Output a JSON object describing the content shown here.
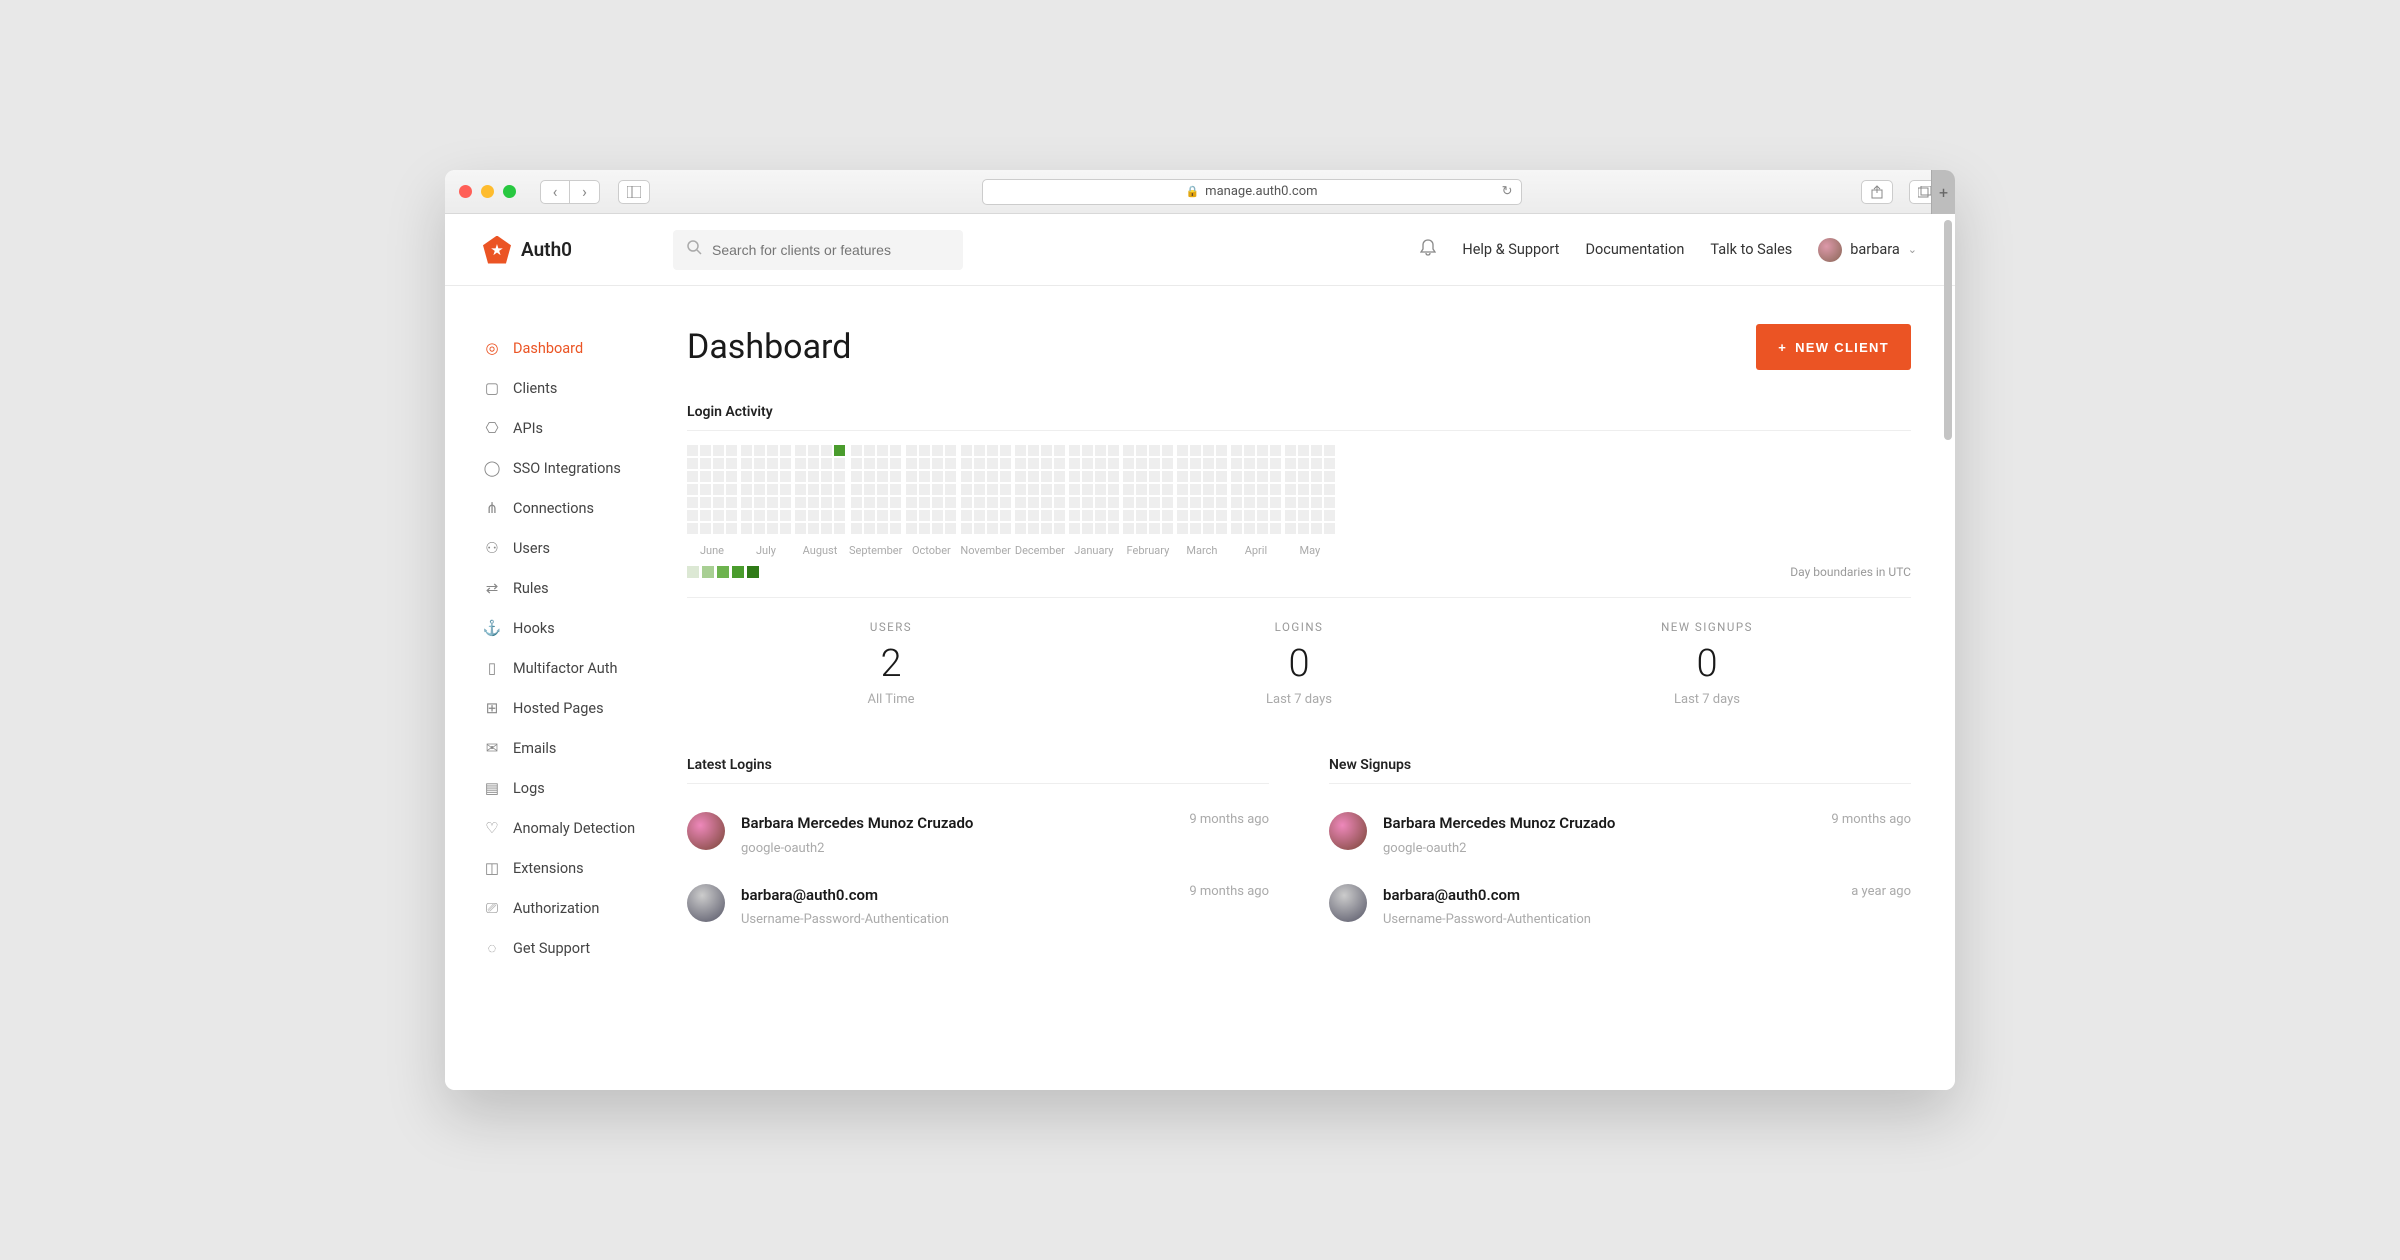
{
  "browser": {
    "url_host": "manage.auth0.com"
  },
  "brand": "Auth0",
  "search": {
    "placeholder": "Search for clients or features"
  },
  "topnav": {
    "help": "Help & Support",
    "docs": "Documentation",
    "sales": "Talk to Sales",
    "user": "barbara"
  },
  "sidebar": {
    "items": [
      {
        "label": "Dashboard",
        "icon": "◎",
        "active": true
      },
      {
        "label": "Clients",
        "icon": "▢"
      },
      {
        "label": "APIs",
        "icon": "⎔"
      },
      {
        "label": "SSO Integrations",
        "icon": "◯"
      },
      {
        "label": "Connections",
        "icon": "⋔"
      },
      {
        "label": "Users",
        "icon": "⚇"
      },
      {
        "label": "Rules",
        "icon": "⇄"
      },
      {
        "label": "Hooks",
        "icon": "⚓"
      },
      {
        "label": "Multifactor Auth",
        "icon": "▯"
      },
      {
        "label": "Hosted Pages",
        "icon": "⊞"
      },
      {
        "label": "Emails",
        "icon": "✉"
      },
      {
        "label": "Logs",
        "icon": "▤"
      },
      {
        "label": "Anomaly Detection",
        "icon": "♡"
      },
      {
        "label": "Extensions",
        "icon": "◫"
      },
      {
        "label": "Authorization",
        "icon": "⎚"
      },
      {
        "label": "Get Support",
        "icon": "◌"
      }
    ]
  },
  "page": {
    "title": "Dashboard",
    "new_btn": "NEW CLIENT"
  },
  "activity": {
    "heading": "Login Activity",
    "months": [
      "June",
      "July",
      "August",
      "September",
      "October",
      "November",
      "December",
      "January",
      "February",
      "March",
      "April",
      "May"
    ],
    "utc_note": "Day boundaries in UTC",
    "active_cell": {
      "month_index": 2,
      "cell_index": 3
    }
  },
  "stats": [
    {
      "label": "USERS",
      "value": "2",
      "sub": "All Time"
    },
    {
      "label": "LOGINS",
      "value": "0",
      "sub": "Last 7 days"
    },
    {
      "label": "NEW SIGNUPS",
      "value": "0",
      "sub": "Last 7 days"
    }
  ],
  "latest_logins": {
    "heading": "Latest Logins",
    "items": [
      {
        "name": "Barbara Mercedes Munoz Cruzado",
        "provider": "google-oauth2",
        "time": "9 months ago"
      },
      {
        "name": "barbara@auth0.com",
        "provider": "Username-Password-Authentication",
        "time": "9 months ago"
      }
    ]
  },
  "new_signups": {
    "heading": "New Signups",
    "items": [
      {
        "name": "Barbara Mercedes Munoz Cruzado",
        "provider": "google-oauth2",
        "time": "9 months ago"
      },
      {
        "name": "barbara@auth0.com",
        "provider": "Username-Password-Authentication",
        "time": "a year ago"
      }
    ]
  }
}
